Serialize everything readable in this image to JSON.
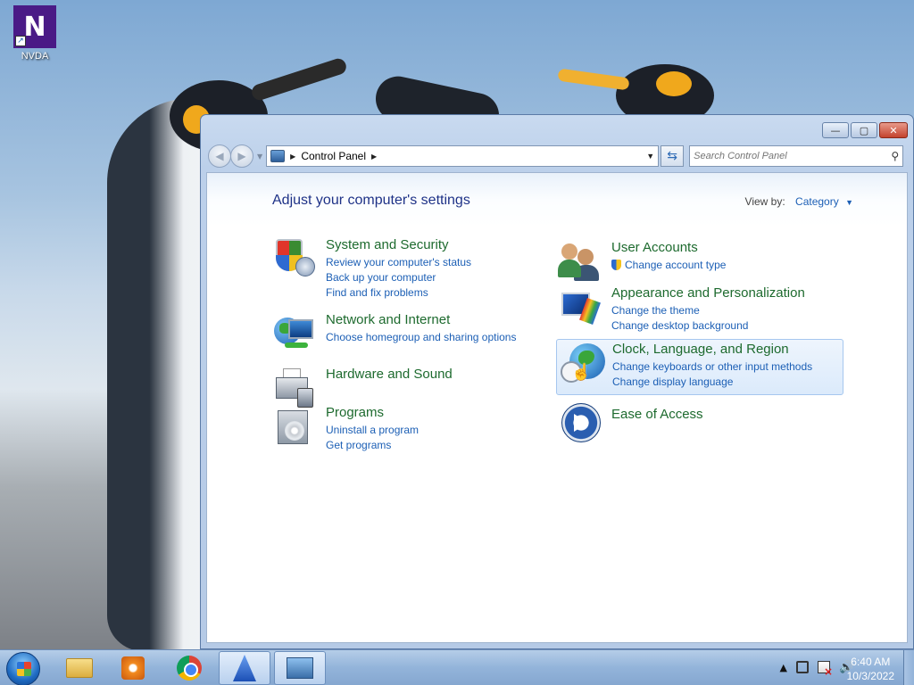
{
  "desktop": {
    "icons": [
      {
        "label": "NVDA",
        "glyph": "N"
      }
    ]
  },
  "window": {
    "title_buttons": {
      "minimize": "—",
      "maximize": "▢",
      "close": "✕"
    },
    "address": {
      "crumb": "Control Panel"
    },
    "search": {
      "placeholder": "Search Control Panel"
    },
    "page_title": "Adjust your computer's settings",
    "view_by": {
      "label": "View by:",
      "value": "Category"
    },
    "categories_left": [
      {
        "title": "System and Security",
        "icon": "shield-icon",
        "links": [
          "Review your computer's status",
          "Back up your computer",
          "Find and fix problems"
        ]
      },
      {
        "title": "Network and Internet",
        "icon": "globe-network-icon",
        "links": [
          "Choose homegroup and sharing options"
        ]
      },
      {
        "title": "Hardware and Sound",
        "icon": "printer-icon",
        "links": []
      },
      {
        "title": "Programs",
        "icon": "programs-icon",
        "links": [
          "Uninstall a program",
          "Get programs"
        ]
      }
    ],
    "categories_right": [
      {
        "title": "User Accounts",
        "icon": "users-icon",
        "links": [
          "Change account type"
        ]
      },
      {
        "title": "Appearance and Personalization",
        "icon": "monitor-brush-icon",
        "links": [
          "Change the theme",
          "Change desktop background"
        ]
      },
      {
        "title": "Clock, Language, and Region",
        "icon": "clock-globe-icon",
        "links": [
          "Change keyboards or other input methods",
          "Change display language"
        ]
      },
      {
        "title": "Ease of Access",
        "icon": "ease-of-access-icon",
        "links": []
      }
    ]
  },
  "taskbar": {
    "items": [
      "windows-explorer-icon",
      "media-player-icon",
      "chrome-icon",
      "nvda-icon",
      "control-panel-icon"
    ],
    "clock": {
      "time": "6:40 AM",
      "date": "10/3/2022"
    },
    "tray_expand": "▲"
  }
}
